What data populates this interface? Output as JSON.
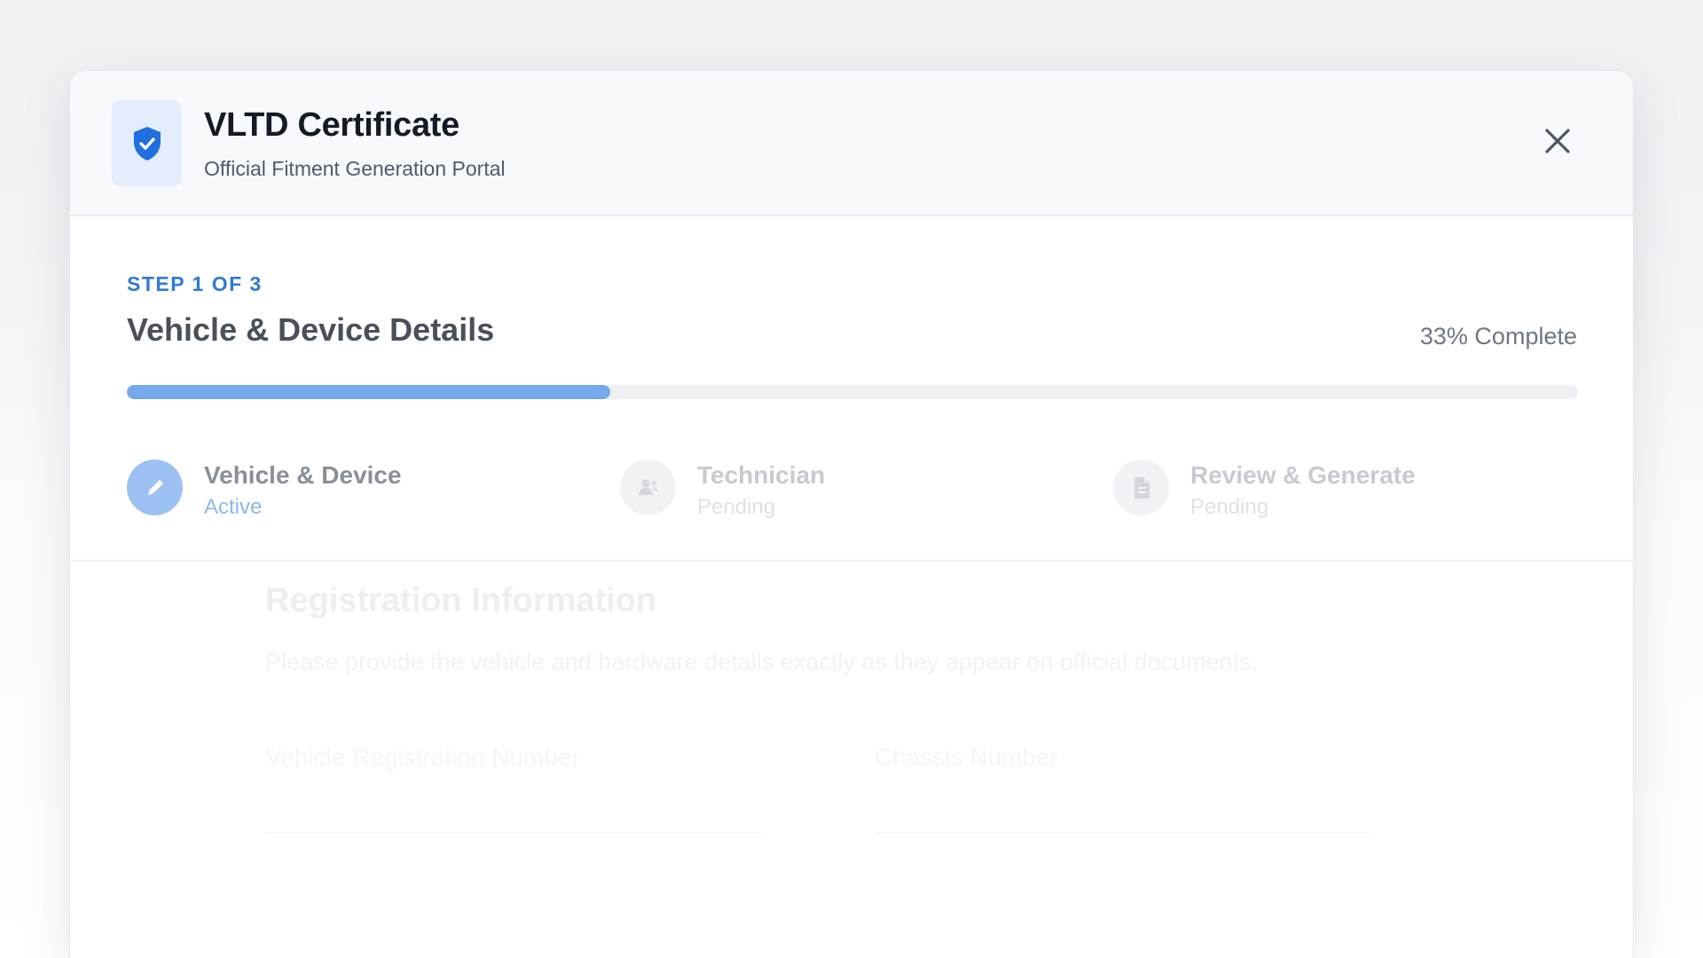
{
  "header": {
    "title": "VLTD Certificate",
    "subtitle": "Official Fitment Generation Portal",
    "icon": "shield-check-icon",
    "close_icon": "close-icon"
  },
  "progress": {
    "step_label": "STEP 1 OF 3",
    "step_title": "Vehicle & Device Details",
    "percent_text": "33% Complete",
    "fraction": 0.333
  },
  "steps": [
    {
      "name": "Vehicle & Device",
      "status": "Active",
      "icon": "pencil-icon"
    },
    {
      "name": "Technician",
      "status": "Pending",
      "icon": "user-icon"
    },
    {
      "name": "Review & Generate",
      "status": "Pending",
      "icon": "document-icon"
    }
  ],
  "section": {
    "title": "Registration Information",
    "description": "Please provide the vehicle and hardware details exactly as they appear on official documents.",
    "fields": [
      {
        "label": "Vehicle Registration Number"
      },
      {
        "label": "Chassis Number"
      }
    ]
  },
  "colors": {
    "accent": "#2f7ad6",
    "progress_fill": "#76a8ec",
    "active_step": "#9cc1f2",
    "shield": "#1f6fe0"
  }
}
